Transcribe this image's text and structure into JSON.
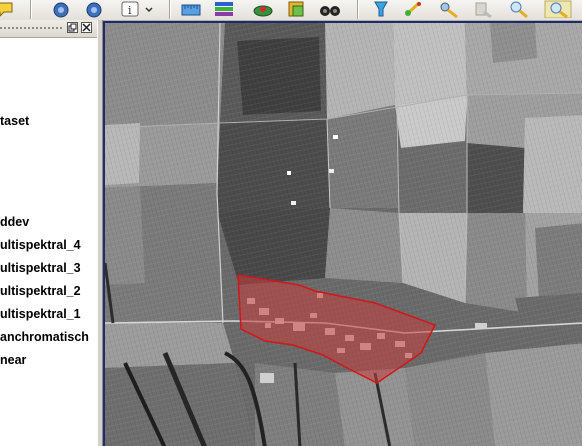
{
  "toolbar": {
    "buttons": [
      "chat-bubble-icon",
      "pan-left-icon",
      "pan-right-icon",
      "identify-info-icon",
      "measure-ruler-icon",
      "legend-icon",
      "map-tips-icon",
      "add-layer-icon",
      "binoculars-icon",
      "select-icon",
      "vertex-edit-icon",
      "digitize-icon",
      "move-feature-icon",
      "zoom-icon",
      "hammer-icon"
    ]
  },
  "panel": {
    "layers": [
      {
        "label": "taset"
      },
      {
        "label": "ddev"
      },
      {
        "label": "ultispektral_4"
      },
      {
        "label": "ultispektral_3"
      },
      {
        "label": "ultispektral_2"
      },
      {
        "label": "ultispektral_1"
      },
      {
        "label": "anchromatisch"
      },
      {
        "label": "near"
      }
    ]
  },
  "colors": {
    "selection_fill": "#c83c3c",
    "selection_stroke": "#d01818",
    "map_frame": "#1e2a6e"
  }
}
